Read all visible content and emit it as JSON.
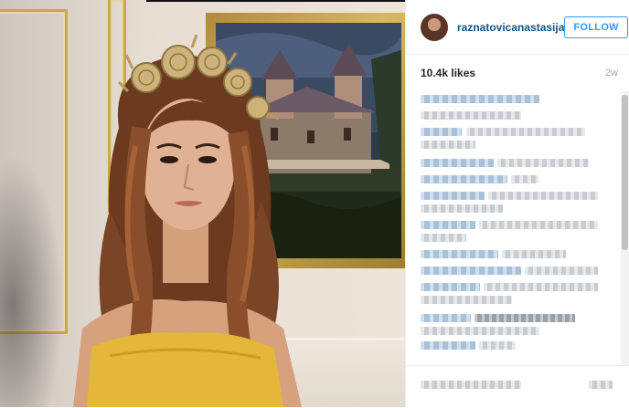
{
  "post": {
    "username": "raznatovicanastasija",
    "follow_label": "FOLLOW",
    "likes": "10.4k likes",
    "time_ago": "2w"
  },
  "colors": {
    "username": "#125688",
    "follow_accent": "#3897f0",
    "meta_gray": "#a5a7aa"
  },
  "comments_note": "blurred"
}
